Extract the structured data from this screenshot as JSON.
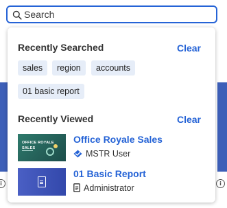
{
  "search": {
    "placeholder": "Search"
  },
  "recently_searched": {
    "title": "Recently Searched",
    "clear_label": "Clear",
    "terms": [
      "sales",
      "region",
      "accounts",
      "01 basic report"
    ]
  },
  "recently_viewed": {
    "title": "Recently Viewed",
    "clear_label": "Clear",
    "items": [
      {
        "title": "Office Royale Sales",
        "subtitle": "MSTR User",
        "thumbnail_text": "OFFICE ROYALE SALES",
        "subtitle_icon": "certified-shared-icon"
      },
      {
        "title": "01 Basic Report",
        "subtitle": "Administrator",
        "subtitle_icon": "document-icon"
      }
    ]
  },
  "colors": {
    "accent": "#2563d6",
    "chip_bg": "#e6edf8"
  }
}
